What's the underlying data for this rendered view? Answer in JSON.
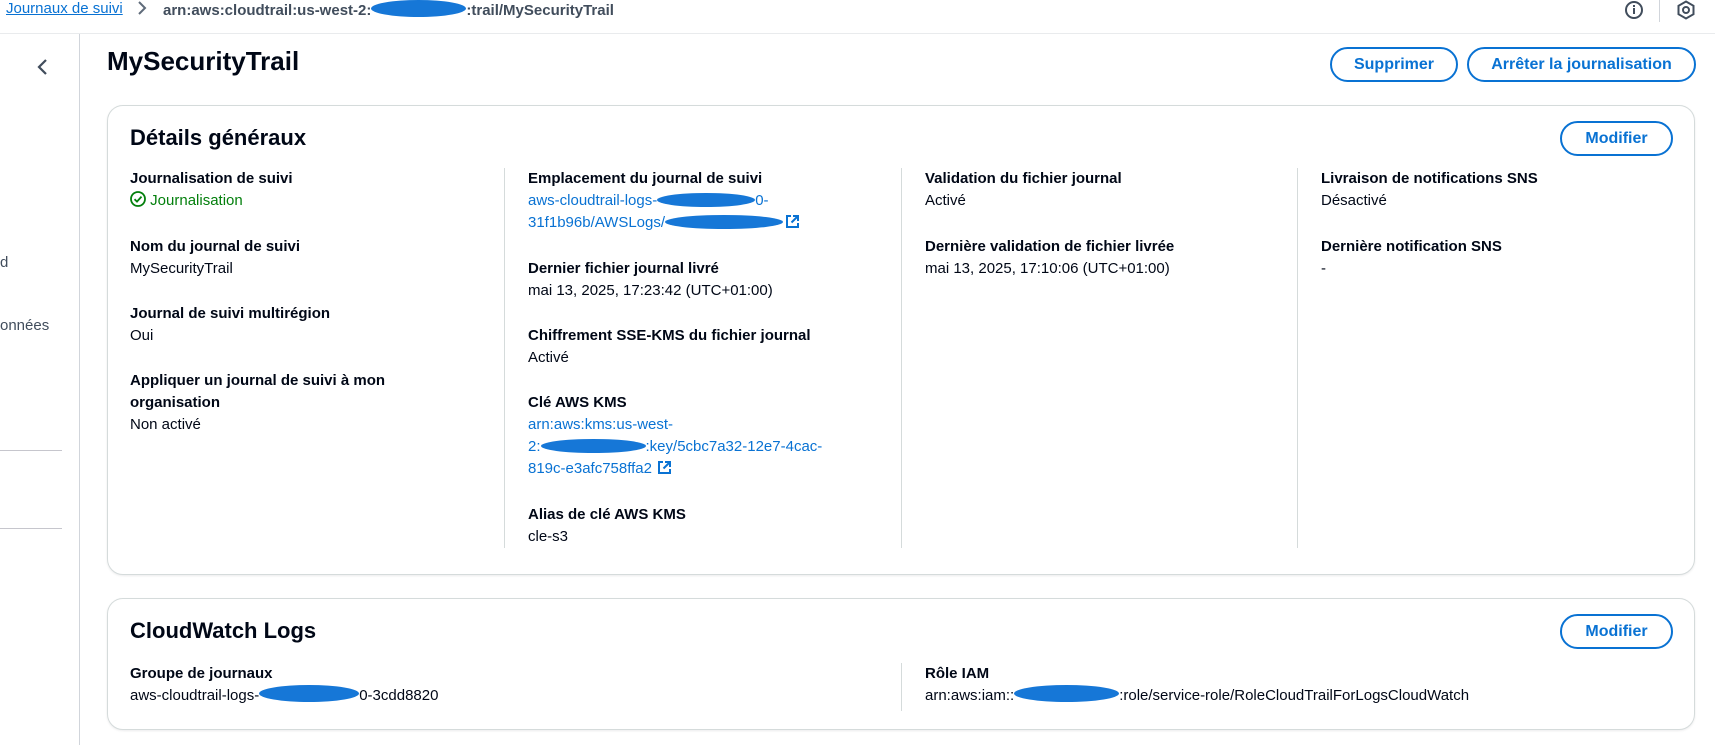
{
  "breadcrumb": {
    "parent": "Journaux de suivi",
    "separator": ">",
    "current_prefix": "arn:aws:cloudtrail:us-west-2:",
    "current_suffix": ":trail/MySecurityTrail"
  },
  "topbar_icons": [
    "info-icon",
    "settings-hex-icon"
  ],
  "sidebar": {
    "fragments": [
      "d",
      "onnées"
    ]
  },
  "page": {
    "title": "MySecurityTrail",
    "delete_label": "Supprimer",
    "stop_label": "Arrêter la journalisation"
  },
  "general": {
    "title": "Détails généraux",
    "edit_label": "Modifier",
    "logging_label": "Journalisation de suivi",
    "logging_value": "Journalisation",
    "name_label": "Nom du journal de suivi",
    "name_value": "MySecurityTrail",
    "multiregion_label": "Journal de suivi multirégion",
    "multiregion_value": "Oui",
    "org_label": "Appliquer un journal de suivi à mon organisation",
    "org_value": "Non activé",
    "location_label": "Emplacement du journal de suivi",
    "location_line1_prefix": "aws-cloudtrail-logs-",
    "location_line1_suffix": "0-",
    "location_line2_prefix": "31f1b96b/AWSLogs/",
    "last_delivered_label": "Dernier fichier journal livré",
    "last_delivered_value": "mai 13, 2025, 17:23:42 (UTC+01:00)",
    "sse_label": "Chiffrement SSE-KMS du fichier journal",
    "sse_value": "Activé",
    "kms_key_label": "Clé AWS KMS",
    "kms_line1": "arn:aws:kms:us-west-",
    "kms_line2_prefix": "2:",
    "kms_line2_suffix": ":key/5cbc7a32-12e7-4cac-",
    "kms_line3": "819c-e3afc758ffa2",
    "kms_alias_label": "Alias de clé AWS KMS",
    "kms_alias_value": "cle-s3",
    "validation_label": "Validation du fichier journal",
    "validation_value": "Activé",
    "last_validation_label": "Dernière validation de fichier livrée",
    "last_validation_value": "mai 13, 2025, 17:10:06 (UTC+01:00)",
    "sns_label": "Livraison de notifications SNS",
    "sns_value": "Désactivé",
    "last_sns_label": "Dernière notification SNS",
    "last_sns_value": "-"
  },
  "cloudwatch": {
    "title": "CloudWatch Logs",
    "edit_label": "Modifier",
    "group_label": "Groupe de journaux",
    "group_prefix": "aws-cloudtrail-logs-",
    "group_suffix": "0-3cdd8820",
    "role_label": "Rôle IAM",
    "role_prefix": "arn:aws:iam::",
    "role_suffix": ":role/service-role/RoleCloudTrailForLogsCloudWatch"
  },
  "colors": {
    "link": "#0972d3",
    "success": "#037f0c",
    "redaction": "#1677d7"
  }
}
